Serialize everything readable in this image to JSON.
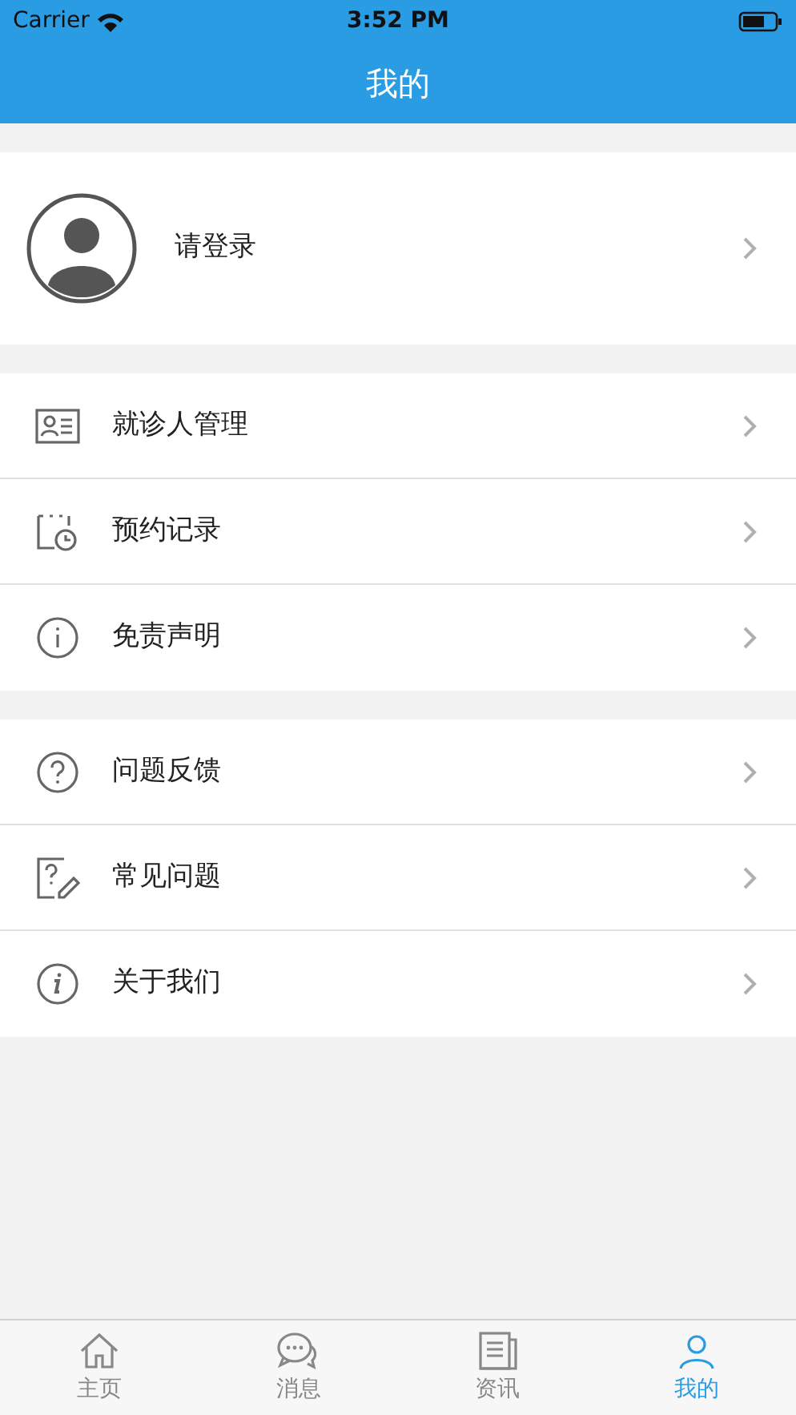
{
  "status_bar": {
    "carrier": "Carrier",
    "time": "3:52 PM"
  },
  "nav": {
    "title": "我的"
  },
  "profile": {
    "label": "请登录"
  },
  "groups": [
    [
      {
        "label": "就诊人管理"
      },
      {
        "label": "预约记录"
      },
      {
        "label": "免责声明"
      }
    ],
    [
      {
        "label": "问题反馈"
      },
      {
        "label": "常见问题"
      },
      {
        "label": "关于我们"
      }
    ]
  ],
  "tabs": [
    {
      "label": "主页",
      "selected": false
    },
    {
      "label": "消息",
      "selected": false
    },
    {
      "label": "资讯",
      "selected": false
    },
    {
      "label": "我的",
      "selected": true
    }
  ]
}
